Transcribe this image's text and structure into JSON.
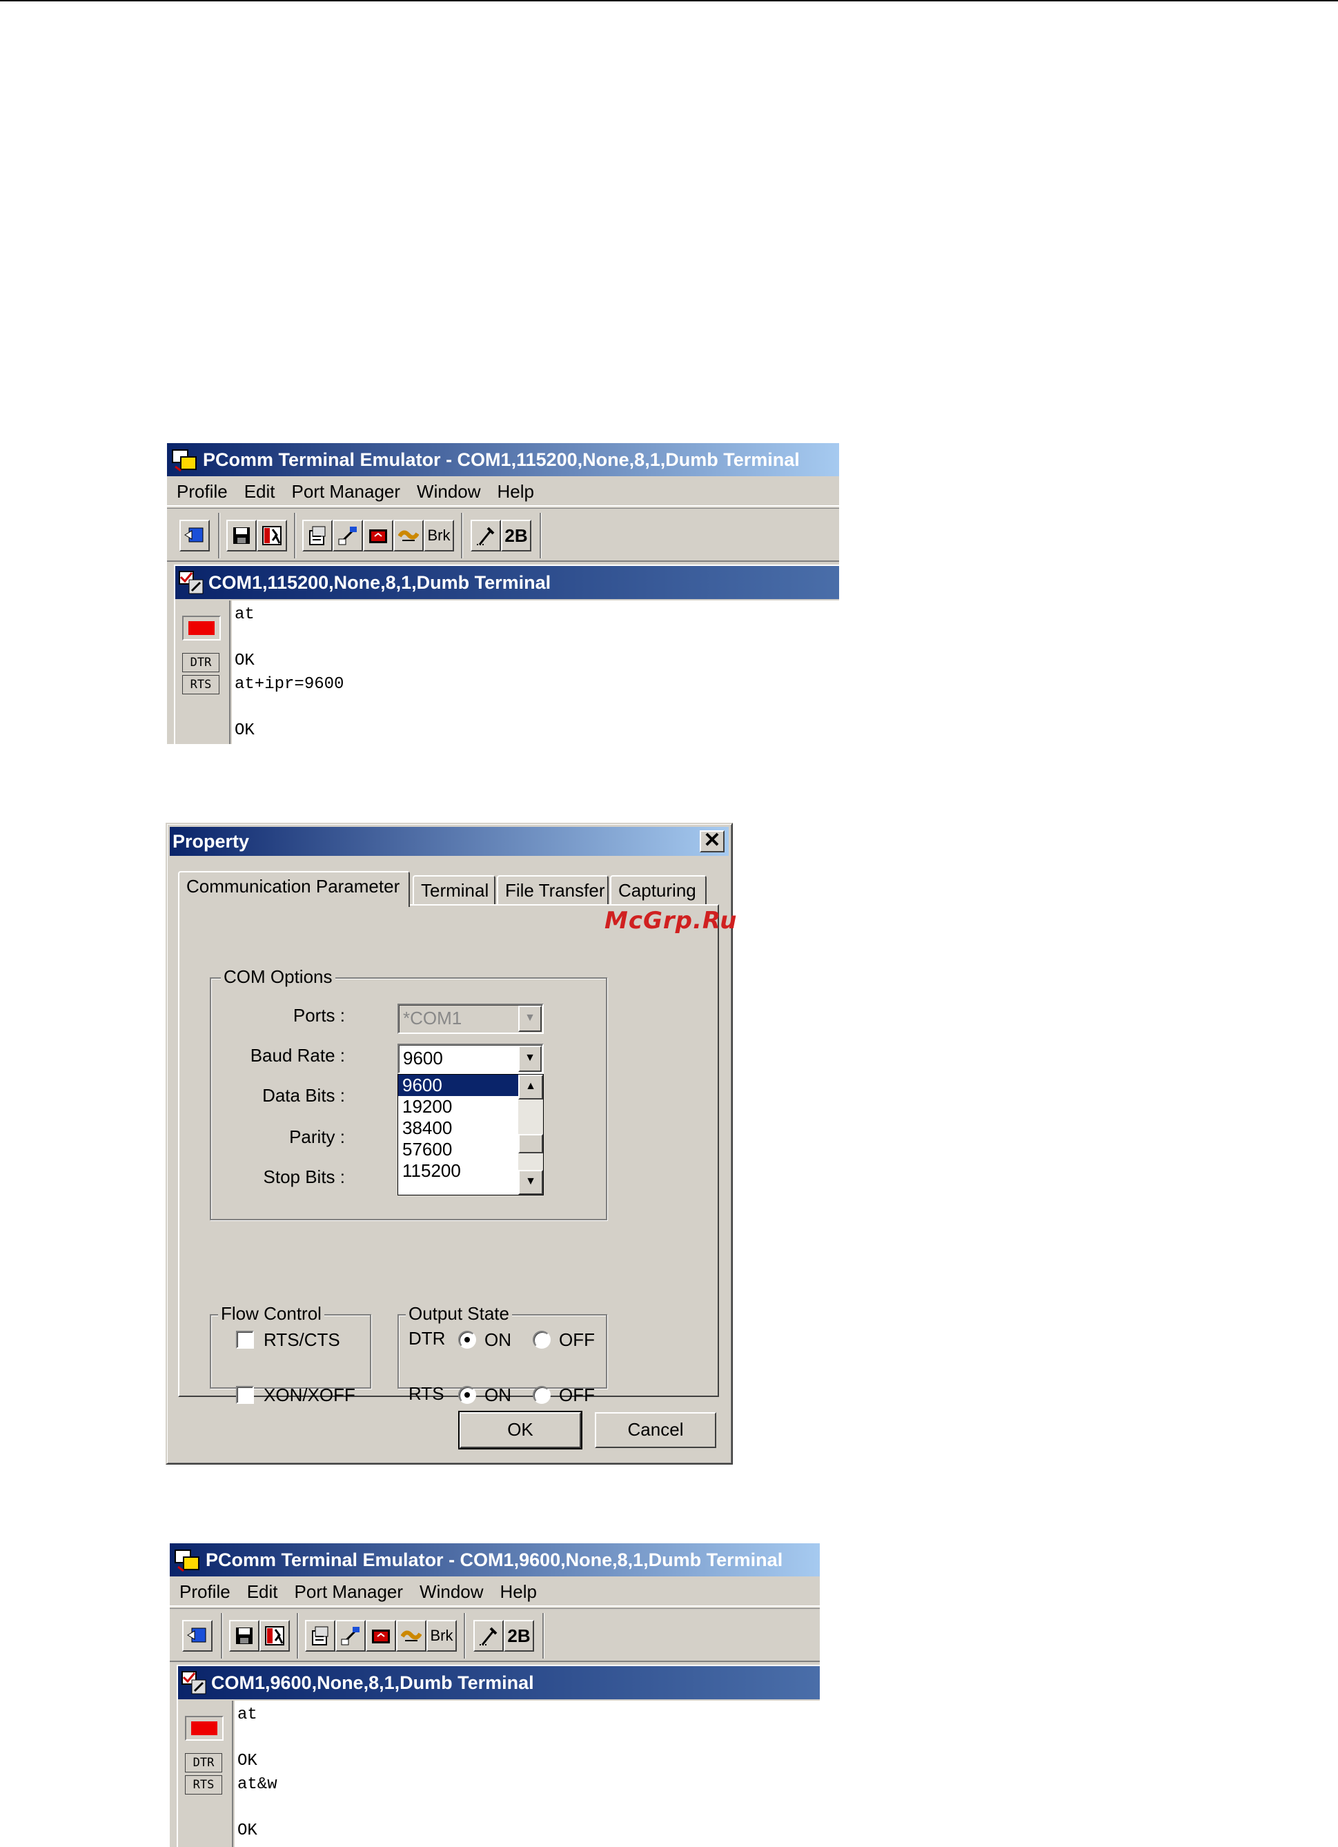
{
  "window1": {
    "title": "PComm Terminal Emulator - COM1,115200,None,8,1,Dumb Terminal",
    "menu": [
      "Profile",
      "Edit",
      "Port Manager",
      "Window",
      "Help"
    ],
    "toolbar": {
      "brk_label": "Brk",
      "twob_label": "2B"
    },
    "mdi_title": "COM1,115200,None,8,1,Dumb Terminal",
    "signals": {
      "dtr": "DTR",
      "rts": "RTS"
    },
    "terminal_lines": [
      "at",
      "",
      "OK",
      "at+ipr=9600",
      "",
      "OK"
    ]
  },
  "dialog": {
    "title": "Property",
    "close_glyph": "✕",
    "tabs": [
      "Communication Parameter",
      "Terminal",
      "File Transfer",
      "Capturing"
    ],
    "com_options": {
      "title": "COM Options",
      "ports_label": "Ports :",
      "ports_value": "*COM1",
      "baud_label": "Baud Rate :",
      "baud_value": "9600",
      "data_bits_label": "Data Bits :",
      "parity_label": "Parity :",
      "stop_bits_label": "Stop Bits :",
      "baud_options": [
        "9600",
        "19200",
        "38400",
        "57600",
        "115200"
      ],
      "selected_option": "9600"
    },
    "flow_control": {
      "title": "Flow Control",
      "rts_cts": "RTS/CTS",
      "xon_xoff": "XON/XOFF",
      "rts_cts_checked": false,
      "xon_xoff_checked": false
    },
    "output_state": {
      "title": "Output State",
      "dtr_label": "DTR",
      "rts_label": "RTS",
      "on_label": "ON",
      "off_label": "OFF",
      "dtr_value": "ON",
      "rts_value": "ON"
    },
    "ok_label": "OK",
    "cancel_label": "Cancel"
  },
  "watermark": "McGrp.Ru",
  "window2": {
    "title": "PComm Terminal Emulator - COM1,9600,None,8,1,Dumb Terminal",
    "menu": [
      "Profile",
      "Edit",
      "Port Manager",
      "Window",
      "Help"
    ],
    "toolbar": {
      "brk_label": "Brk",
      "twob_label": "2B"
    },
    "mdi_title": "COM1,9600,None,8,1,Dumb Terminal",
    "signals": {
      "dtr": "DTR",
      "rts": "RTS"
    },
    "terminal_lines": [
      "at",
      "",
      "OK",
      "at&w",
      "",
      "OK"
    ]
  },
  "colors": {
    "title_blue": "#0a246a",
    "title_light": "#a6caf0",
    "face": "#d4d0c8",
    "led_red": "#ee0000",
    "watermark_red": "#d02020"
  }
}
